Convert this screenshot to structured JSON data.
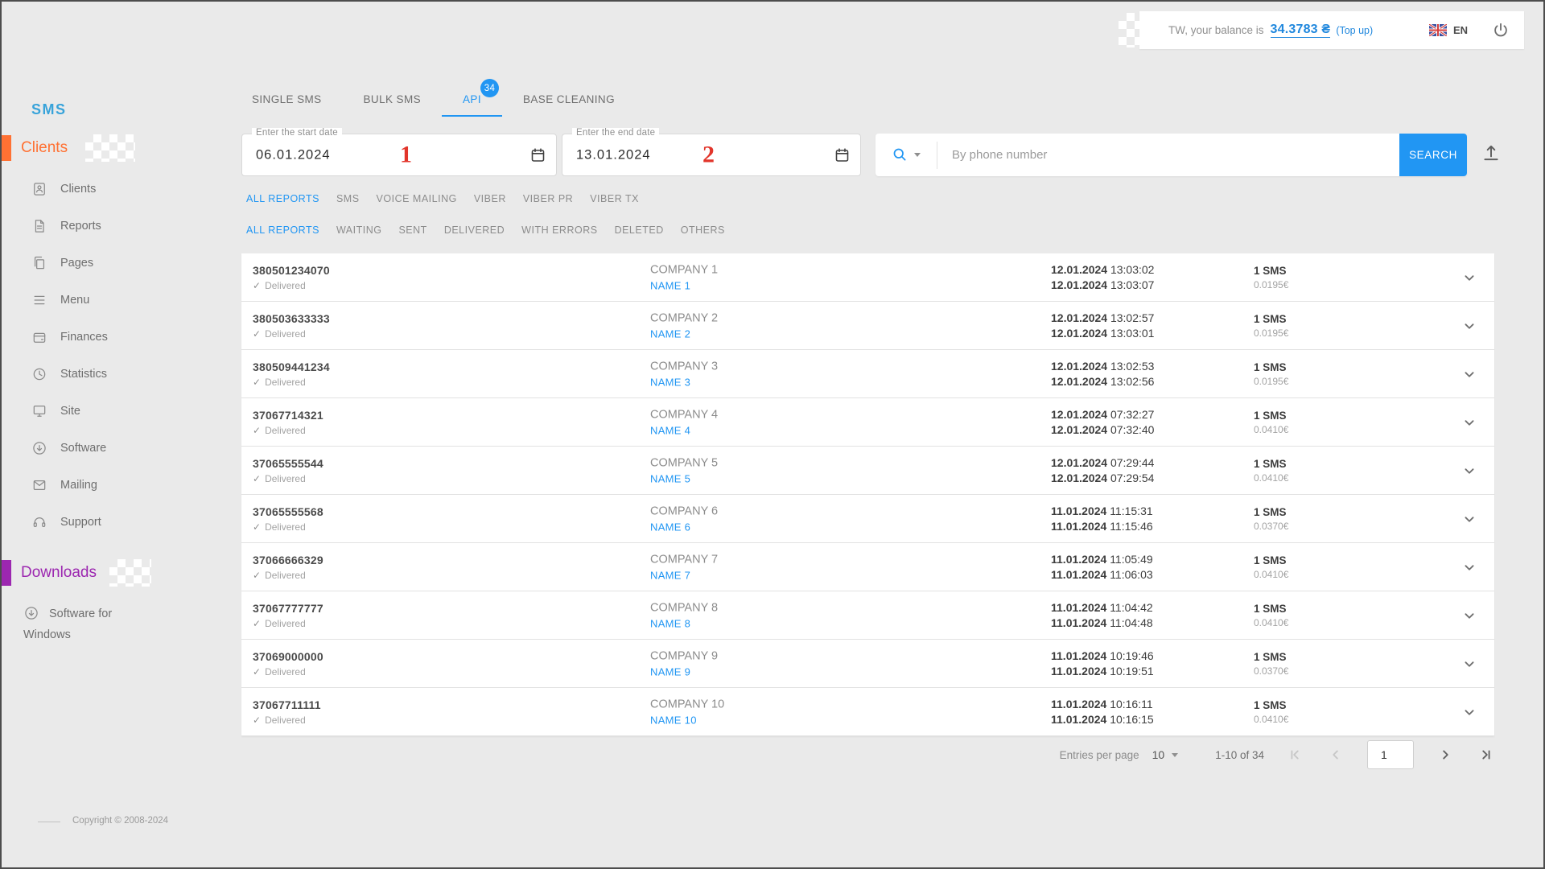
{
  "header": {
    "balance_prefix": "TW, your balance is",
    "balance_amount": "34.3783 ₴",
    "topup": "(Top up)",
    "language": "EN"
  },
  "sidebar": {
    "brand": "SMS",
    "clients_header": "Clients",
    "items": [
      {
        "label": "Clients",
        "icon": "clients-icon"
      },
      {
        "label": "Reports",
        "icon": "reports-icon"
      },
      {
        "label": "Pages",
        "icon": "pages-icon"
      },
      {
        "label": "Menu",
        "icon": "menu-icon"
      },
      {
        "label": "Finances",
        "icon": "finances-icon"
      },
      {
        "label": "Statistics",
        "icon": "statistics-icon"
      },
      {
        "label": "Site",
        "icon": "site-icon"
      },
      {
        "label": "Software",
        "icon": "software-icon"
      },
      {
        "label": "Mailing",
        "icon": "mailing-icon"
      },
      {
        "label": "Support",
        "icon": "support-icon"
      }
    ],
    "downloads_header": "Downloads",
    "software_for_windows": "Software for Windows",
    "copyright": "Copyright © 2008-2024"
  },
  "tabs": [
    {
      "label": "SINGLE SMS",
      "active": false
    },
    {
      "label": "BULK SMS",
      "active": false
    },
    {
      "label": "API",
      "active": true,
      "badge": "34"
    },
    {
      "label": "BASE CLEANING",
      "active": false
    }
  ],
  "date_filters": {
    "start": {
      "label": "Enter the start date",
      "value": "06.01.2024",
      "annotation": "1"
    },
    "end": {
      "label": "Enter the end date",
      "value": "13.01.2024",
      "annotation": "2"
    }
  },
  "search": {
    "placeholder": "By phone number",
    "button": "SEARCH"
  },
  "filters": {
    "type": [
      "ALL REPORTS",
      "SMS",
      "VOICE MAILING",
      "VIBER",
      "VIBER PR",
      "VIBER TX"
    ],
    "status": [
      "ALL REPORTS",
      "WAITING",
      "SENT",
      "DELIVERED",
      "WITH ERRORS",
      "DELETED",
      "OTHERS"
    ]
  },
  "rows": [
    {
      "phone": "380501234070",
      "status": "Delivered",
      "company": "COMPANY 1",
      "name": "NAME 1",
      "sent_date": "12.01.2024",
      "sent_time": "13:03:02",
      "delivered_date": "12.01.2024",
      "delivered_time": "13:03:07",
      "count": "1 SMS",
      "price": "0.0195€"
    },
    {
      "phone": "380503633333",
      "status": "Delivered",
      "company": "COMPANY 2",
      "name": "NAME 2",
      "sent_date": "12.01.2024",
      "sent_time": "13:02:57",
      "delivered_date": "12.01.2024",
      "delivered_time": "13:03:01",
      "count": "1 SMS",
      "price": "0.0195€"
    },
    {
      "phone": "380509441234",
      "status": "Delivered",
      "company": "COMPANY 3",
      "name": "NAME 3",
      "sent_date": "12.01.2024",
      "sent_time": "13:02:53",
      "delivered_date": "12.01.2024",
      "delivered_time": "13:02:56",
      "count": "1 SMS",
      "price": "0.0195€"
    },
    {
      "phone": "37067714321",
      "status": "Delivered",
      "company": "COMPANY 4",
      "name": "NAME 4",
      "sent_date": "12.01.2024",
      "sent_time": "07:32:27",
      "delivered_date": "12.01.2024",
      "delivered_time": "07:32:40",
      "count": "1 SMS",
      "price": "0.0410€"
    },
    {
      "phone": "37065555544",
      "status": "Delivered",
      "company": "COMPANY 5",
      "name": "NAME 5",
      "sent_date": "12.01.2024",
      "sent_time": "07:29:44",
      "delivered_date": "12.01.2024",
      "delivered_time": "07:29:54",
      "count": "1 SMS",
      "price": "0.0410€"
    },
    {
      "phone": "37065555568",
      "status": "Delivered",
      "company": "COMPANY 6",
      "name": "NAME 6",
      "sent_date": "11.01.2024",
      "sent_time": "11:15:31",
      "delivered_date": "11.01.2024",
      "delivered_time": "11:15:46",
      "count": "1 SMS",
      "price": "0.0370€"
    },
    {
      "phone": "37066666329",
      "status": "Delivered",
      "company": "COMPANY 7",
      "name": "NAME 7",
      "sent_date": "11.01.2024",
      "sent_time": "11:05:49",
      "delivered_date": "11.01.2024",
      "delivered_time": "11:06:03",
      "count": "1 SMS",
      "price": "0.0410€"
    },
    {
      "phone": "37067777777",
      "status": "Delivered",
      "company": "COMPANY 8",
      "name": "NAME 8",
      "sent_date": "11.01.2024",
      "sent_time": "11:04:42",
      "delivered_date": "11.01.2024",
      "delivered_time": "11:04:48",
      "count": "1 SMS",
      "price": "0.0410€"
    },
    {
      "phone": "37069000000",
      "status": "Delivered",
      "company": "COMPANY 9",
      "name": "NAME 9",
      "sent_date": "11.01.2024",
      "sent_time": "10:19:46",
      "delivered_date": "11.01.2024",
      "delivered_time": "10:19:51",
      "count": "1 SMS",
      "price": "0.0370€"
    },
    {
      "phone": "37067711111",
      "status": "Delivered",
      "company": "COMPANY 10",
      "name": "NAME 10",
      "sent_date": "11.01.2024",
      "sent_time": "10:16:11",
      "delivered_date": "11.01.2024",
      "delivered_time": "10:16:15",
      "count": "1 SMS",
      "price": "0.0410€"
    }
  ],
  "pagination": {
    "entries_label": "Entries per page",
    "per_page": "10",
    "range": "1-10 of 34",
    "page": "1"
  },
  "colors": {
    "accent": "#2196f3",
    "clients_orange": "#ff7133",
    "downloads_purple": "#9c27b0",
    "brand_blue": "#38a3da",
    "annotation_red": "#e2352b"
  }
}
